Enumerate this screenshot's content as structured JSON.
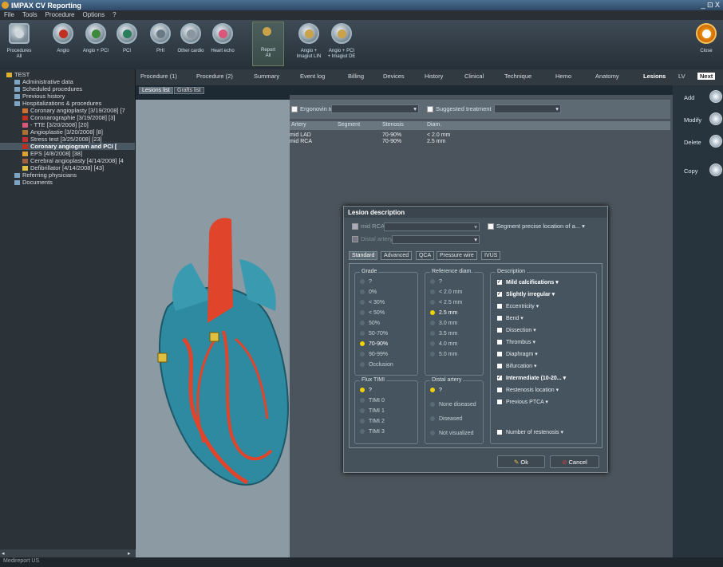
{
  "window": {
    "title": "IMPAX CV Reporting",
    "controls": "_ ⊡ X"
  },
  "menu": [
    "File",
    "Tools",
    "Procedure",
    "Options",
    "?"
  ],
  "toolbar": {
    "procedures": {
      "line1": "Procedures",
      "line2": "All"
    },
    "items": [
      {
        "label": "Angio",
        "color": "#c03020"
      },
      {
        "label": "Angio + PCI",
        "color": "#3e8a3c"
      },
      {
        "label": "PCI",
        "color": "#2a7e5c"
      },
      {
        "label": "PHI",
        "color": "#6a7a84"
      },
      {
        "label": "Other cardio",
        "color": "#8a96a0"
      },
      {
        "label": "Heart echo",
        "color": "#d8577a"
      }
    ],
    "report": {
      "line1": "Report",
      "line2": "All"
    },
    "report_items": [
      {
        "line1": "Angio +",
        "line2": "Imagiut LIN",
        "color": "#c9a24a"
      },
      {
        "line1": "Angio + PCI",
        "line2": "+ Imagiut DE",
        "color": "#c9a24a"
      }
    ],
    "close_label": "Close"
  },
  "tree": {
    "root": "TEST",
    "items": [
      {
        "level": 1,
        "label": "Administrative data"
      },
      {
        "level": 1,
        "label": "Scheduled procedures"
      },
      {
        "level": 1,
        "label": "Previous history"
      },
      {
        "level": 1,
        "label": "Hospitalizations & procedures"
      },
      {
        "level": 2,
        "label": "Coronary angioplasty [3/19/2008] [7"
      },
      {
        "level": 2,
        "label": "Coronarographie [3/19/2008] [3]"
      },
      {
        "level": 2,
        "label": "- TTE [3/20/2008] [20]"
      },
      {
        "level": 2,
        "label": "Angioplastie [3/20/2008] [8]"
      },
      {
        "level": 2,
        "label": "Stress test [3/25/2008] [23]"
      },
      {
        "level": 2,
        "label": "Coronary angiogram and PCI [",
        "selected": true
      },
      {
        "level": 2,
        "label": "EPS [4/8/2008] [38]"
      },
      {
        "level": 2,
        "label": "Cerebral angioplasty [4/14/2008] [4"
      },
      {
        "level": 2,
        "label": "Defibrillator [4/14/2008] [43]"
      },
      {
        "level": 1,
        "label": "Referring physicians"
      },
      {
        "level": 1,
        "label": "Documents"
      }
    ]
  },
  "tabs": [
    "Procedure (1)",
    "Procedure (2)",
    "Summary",
    "Event log",
    "Billing",
    "Devices",
    "History",
    "Clinical",
    "Technique",
    "Hemo",
    "Anatomy",
    "Lesions",
    "LV",
    "Next"
  ],
  "active_tab": "Lesions",
  "subtabs": [
    "Lesions list",
    "Grafts list"
  ],
  "lesion_table": {
    "ergonovin": "Ergonovin test",
    "suggested": "Suggested treatment",
    "columns": [
      "Artery",
      "Segment",
      "Stenosis",
      "Diam."
    ],
    "rows": [
      [
        "mid LAD",
        "",
        "70-90%",
        "< 2.0 mm"
      ],
      [
        "mid RCA",
        "",
        "70-90%",
        "2.5 mm"
      ]
    ]
  },
  "actions": [
    "Add",
    "Modify",
    "Delete",
    "Copy"
  ],
  "dialog": {
    "title": "Lesion description",
    "artery": "mid RCA",
    "distal_site": "Distal artery site",
    "segment_precise": "Segment precise location of a...",
    "tabs": [
      "Standard",
      "Advanced",
      "QCA",
      "Pressure wire",
      "IVUS"
    ],
    "grade": {
      "title": "Grade",
      "options": [
        "?",
        "0%",
        "< 30%",
        "< 50%",
        "50%",
        "50-70%",
        "70-90%",
        "90-99%",
        "Occlusion"
      ],
      "selected": 6
    },
    "ref_diam": {
      "title": "Reference diam.",
      "options": [
        "?",
        "< 2.0 mm",
        "< 2.5 mm",
        "2.5 mm",
        "3.0 mm",
        "3.5 mm",
        "4.0 mm",
        "5.0 mm"
      ],
      "selected": 3
    },
    "flux": {
      "title": "Flux TIMI",
      "options": [
        "?",
        "TIMI 0",
        "TIMI 1",
        "TIMI 2",
        "TIMI 3"
      ],
      "selected": 0
    },
    "distal": {
      "title": "Distal artery",
      "options": [
        "?",
        "None diseased",
        "Diseased",
        "Not visualized"
      ],
      "selected": 0
    },
    "description": {
      "title": "Description",
      "items": [
        {
          "label": "Mild calcifications",
          "checked": true
        },
        {
          "label": "Slightly irregular",
          "checked": true
        },
        {
          "label": "Eccentricity",
          "checked": false
        },
        {
          "label": "Bend",
          "checked": false
        },
        {
          "label": "Dissection",
          "checked": false
        },
        {
          "label": "Thrombus",
          "checked": false
        },
        {
          "label": "Diaphragm",
          "checked": false
        },
        {
          "label": "Bifurcation",
          "checked": false
        },
        {
          "label": "Intermediate (10-20...",
          "checked": true
        },
        {
          "label": "Restenosis location",
          "checked": false
        },
        {
          "label": "Previous PTCA",
          "checked": false
        }
      ],
      "restenosis_count": "Number of restenosis"
    },
    "ok": "Ok",
    "cancel": "Cancel"
  },
  "status": "Medireport US"
}
